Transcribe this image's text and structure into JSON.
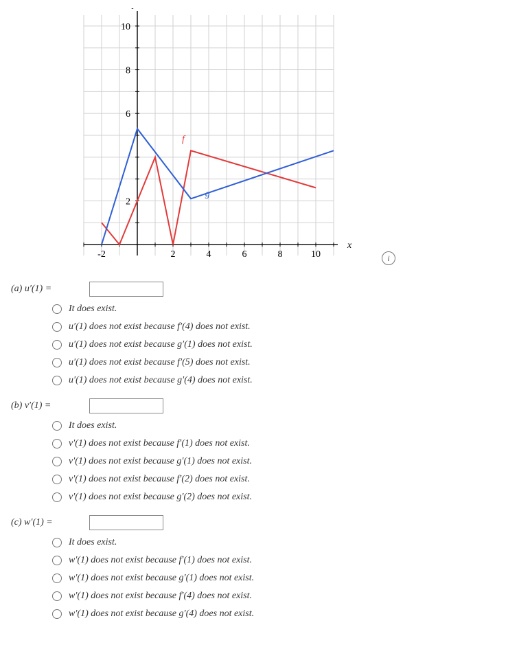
{
  "chart_data": {
    "type": "line",
    "title": "",
    "xlabel": "x",
    "ylabel": "y",
    "xlim": [
      -3,
      11
    ],
    "ylim": [
      -0.5,
      10.5
    ],
    "x_ticks": [
      -2,
      2,
      4,
      6,
      8,
      10
    ],
    "y_ticks": [
      2,
      6,
      8,
      10
    ],
    "series": [
      {
        "name": "f",
        "color": "#e23a3a",
        "points": [
          {
            "x": -2,
            "y": 1
          },
          {
            "x": -1,
            "y": 0
          },
          {
            "x": 1,
            "y": 4
          },
          {
            "x": 2,
            "y": 0
          },
          {
            "x": 3,
            "y": 4.3
          },
          {
            "x": 10,
            "y": 2.6
          }
        ],
        "label_pos": {
          "x": 2.5,
          "y": 4.7
        }
      },
      {
        "name": "g",
        "color": "#3060d6",
        "points": [
          {
            "x": -2,
            "y": 0
          },
          {
            "x": 0,
            "y": 5.3
          },
          {
            "x": 3,
            "y": 2.1
          },
          {
            "x": 11,
            "y": 4.3
          }
        ],
        "label_pos": {
          "x": 3.8,
          "y": 2.2
        }
      }
    ]
  },
  "info_icon": "i",
  "questions": {
    "a": {
      "label": "(a)  u′(1) = ",
      "value": "",
      "options": [
        "It does exist.",
        "u′(1) does not exist because f′(4) does not exist.",
        "u′(1) does not exist because g′(1) does not exist.",
        "u′(1) does not exist because f′(5) does not exist.",
        "u′(1) does not exist because g′(4) does not exist."
      ]
    },
    "b": {
      "label": "(b)  v′(1) = ",
      "value": "",
      "options": [
        "It does exist.",
        "v′(1) does not exist because f′(1) does not exist.",
        "v′(1) does not exist because g′(1) does not exist.",
        "v′(1) does not exist because f′(2) does not exist.",
        "v′(1) does not exist because g′(2) does not exist."
      ]
    },
    "c": {
      "label": "(c)  w′(1) = ",
      "value": "",
      "options": [
        "It does exist.",
        "w′(1) does not exist because f′(1) does not exist.",
        "w′(1) does not exist because g′(1) does not exist.",
        "w′(1) does not exist because f′(4) does not exist.",
        "w′(1) does not exist because g′(4) does not exist."
      ]
    }
  }
}
